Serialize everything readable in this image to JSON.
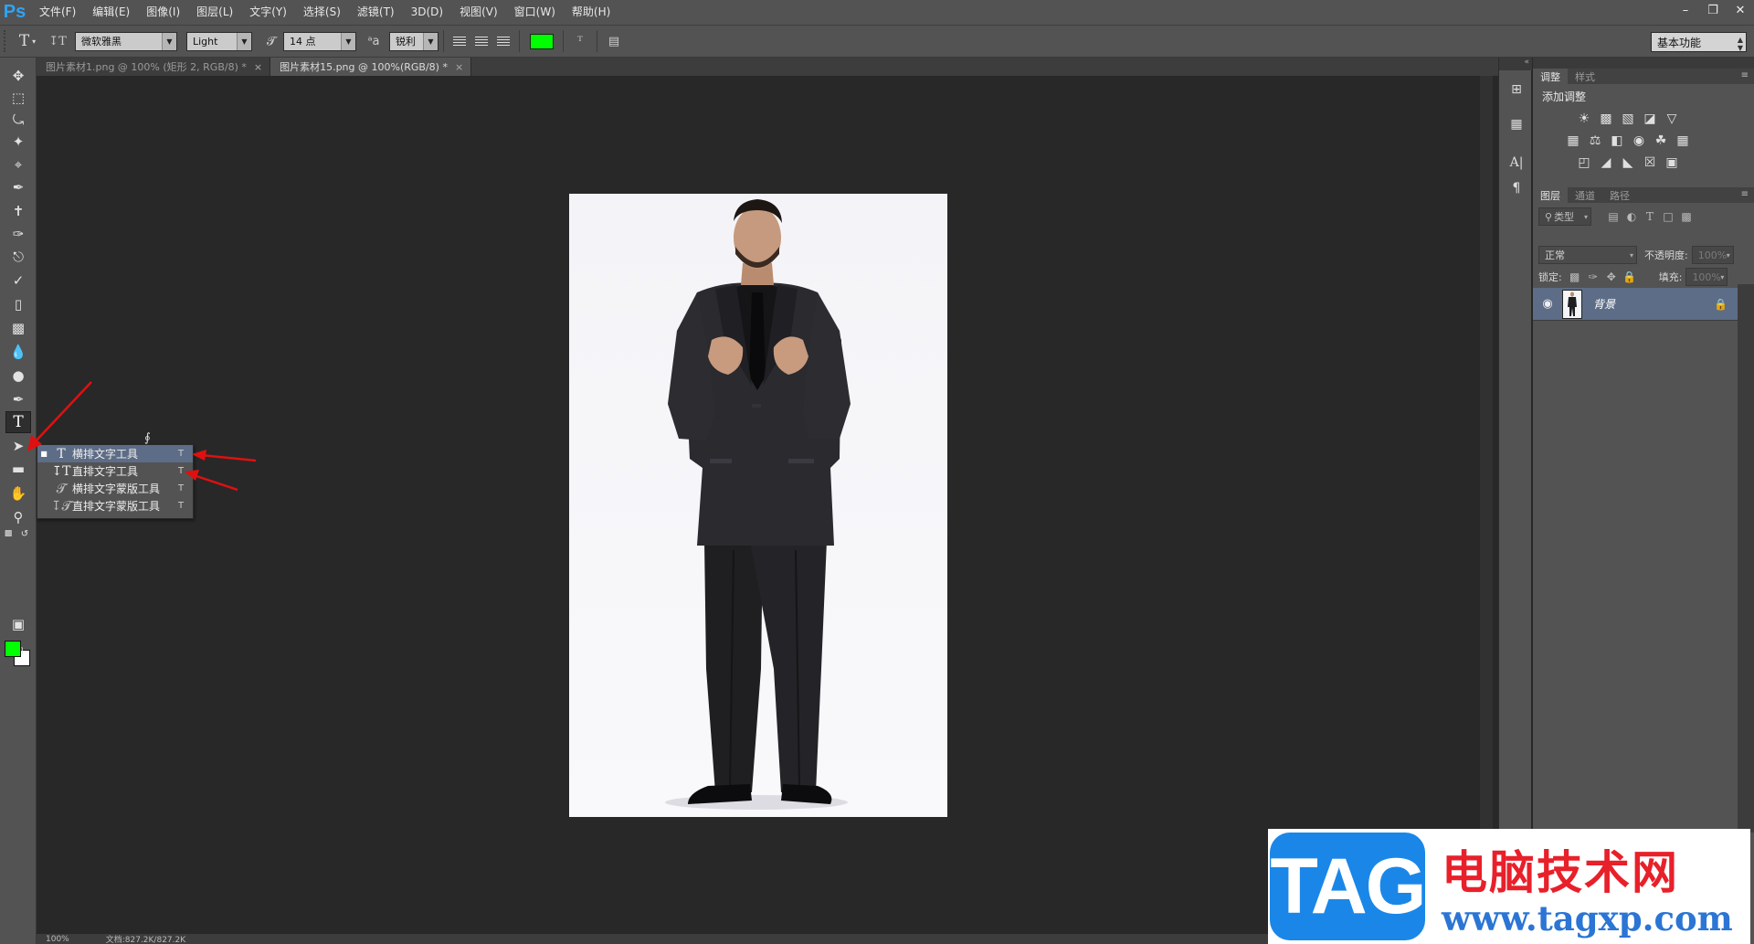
{
  "app": {
    "logo": "Ps"
  },
  "menu": [
    "文件(F)",
    "编辑(E)",
    "图像(I)",
    "图层(L)",
    "文字(Y)",
    "选择(S)",
    "滤镜(T)",
    "3D(D)",
    "视图(V)",
    "窗口(W)",
    "帮助(H)"
  ],
  "options_bar": {
    "font_family": "微软雅黑",
    "font_style": "Light",
    "font_size": "14 点",
    "antialias": "锐利",
    "text_color": "#00ff00",
    "workspace": "基本功能"
  },
  "doc_tabs": [
    {
      "label": "图片素材1.png @ 100% (矩形 2, RGB/8) *",
      "close": "×"
    },
    {
      "label": "图片素材15.png @ 100%(RGB/8) *",
      "close": "×"
    }
  ],
  "tool_flyout": [
    {
      "label": "横排文字工具",
      "key": "T",
      "icon": "horizontal-type-icon"
    },
    {
      "label": "直排文字工具",
      "key": "T",
      "icon": "vertical-type-icon"
    },
    {
      "label": "横排文字蒙版工具",
      "key": "T",
      "icon": "horizontal-type-mask-icon"
    },
    {
      "label": "直排文字蒙版工具",
      "key": "T",
      "icon": "vertical-type-mask-icon"
    }
  ],
  "colors": {
    "foreground": "#00ff00",
    "background": "#ffffff"
  },
  "panels": {
    "adjust_tabs": [
      "调整",
      "样式"
    ],
    "adjust_title": "添加调整",
    "layers_tabs": [
      "图层",
      "通道",
      "路径"
    ],
    "filter_kind": "类型",
    "blend_mode": "正常",
    "opacity_label": "不透明度:",
    "opacity_value": "100%",
    "lock_label": "锁定:",
    "fill_label": "填充:",
    "fill_value": "100%",
    "layer_name": "背景"
  },
  "status": {
    "zoom": "100%",
    "doc_info": "文档:827.2K/827.2K"
  },
  "watermark": {
    "badge": "TAG",
    "title": "电脑技术网",
    "url": "www.tagxp.com"
  }
}
